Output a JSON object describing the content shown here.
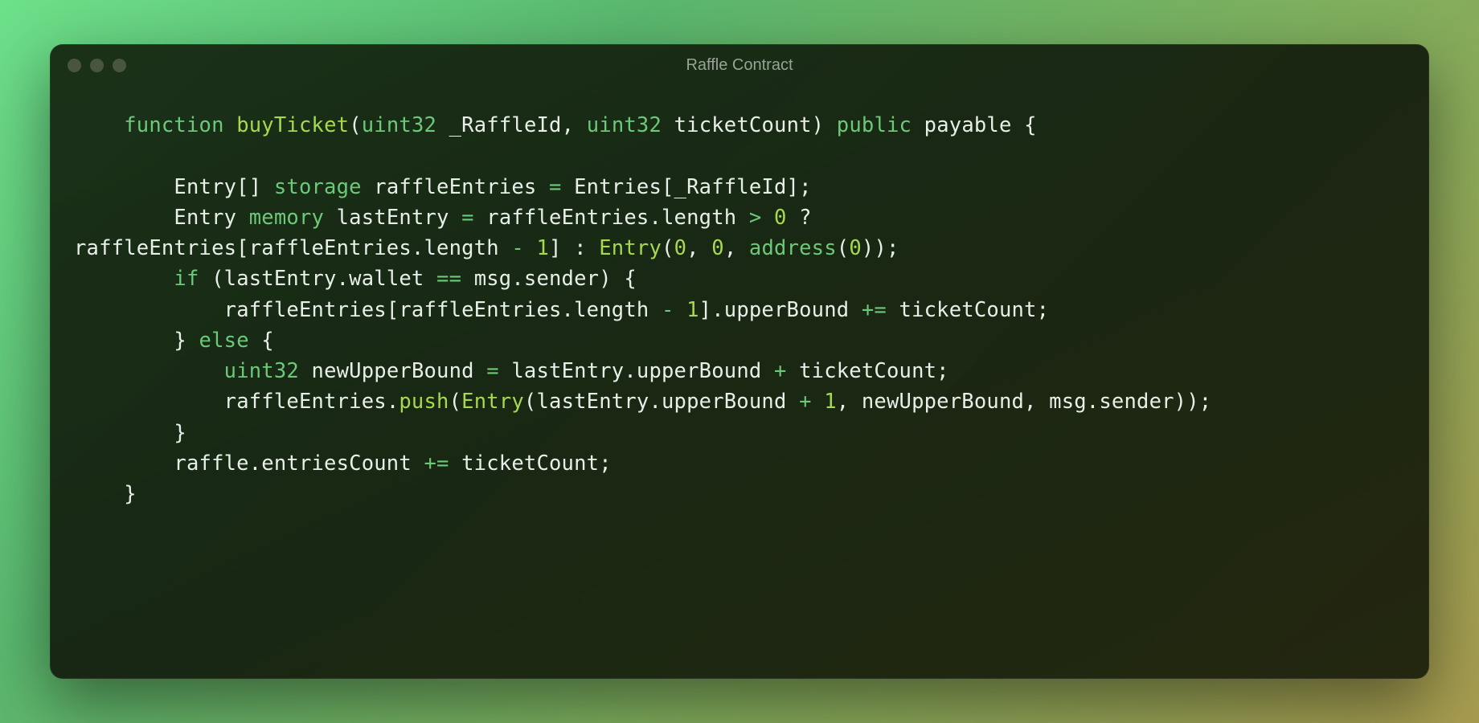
{
  "window": {
    "title": "Raffle Contract"
  },
  "colors": {
    "keyword": "#6cc979",
    "function": "#a7d94f",
    "number": "#a7d94f",
    "text": "#e8eee8",
    "titlebar_text": "#97a396",
    "dot": "#4a5540"
  },
  "code": {
    "lines": [
      {
        "indent": 1,
        "tokens": [
          {
            "t": "function ",
            "c": "kw"
          },
          {
            "t": "buyTicket",
            "c": "fn"
          },
          {
            "t": "(",
            "c": "pu"
          },
          {
            "t": "uint32",
            "c": "ty"
          },
          {
            "t": " _RaffleId, ",
            "c": "pu"
          },
          {
            "t": "uint32",
            "c": "ty"
          },
          {
            "t": " ticketCount) ",
            "c": "pu"
          },
          {
            "t": "public",
            "c": "kw"
          },
          {
            "t": " payable {",
            "c": "pu"
          }
        ]
      },
      {
        "indent": 0,
        "tokens": [
          {
            "t": "",
            "c": "pu"
          }
        ]
      },
      {
        "indent": 2,
        "tokens": [
          {
            "t": "Entry[] ",
            "c": "pu"
          },
          {
            "t": "storage",
            "c": "st"
          },
          {
            "t": " raffleEntries ",
            "c": "pu"
          },
          {
            "t": "=",
            "c": "op"
          },
          {
            "t": " Entries[_RaffleId];",
            "c": "pu"
          }
        ]
      },
      {
        "indent": 2,
        "tokens": [
          {
            "t": "Entry ",
            "c": "pu"
          },
          {
            "t": "memory",
            "c": "st"
          },
          {
            "t": " lastEntry ",
            "c": "pu"
          },
          {
            "t": "=",
            "c": "op"
          },
          {
            "t": " raffleEntries.length ",
            "c": "pu"
          },
          {
            "t": ">",
            "c": "op"
          },
          {
            "t": " ",
            "c": "pu"
          },
          {
            "t": "0",
            "c": "nm"
          },
          {
            "t": " ?",
            "c": "pu"
          }
        ]
      },
      {
        "indent": 0,
        "tokens": [
          {
            "t": "raffleEntries[raffleEntries.length ",
            "c": "pu"
          },
          {
            "t": "-",
            "c": "op"
          },
          {
            "t": " ",
            "c": "pu"
          },
          {
            "t": "1",
            "c": "nm"
          },
          {
            "t": "] : ",
            "c": "pu"
          },
          {
            "t": "Entry",
            "c": "cl"
          },
          {
            "t": "(",
            "c": "pu"
          },
          {
            "t": "0",
            "c": "nm"
          },
          {
            "t": ", ",
            "c": "pu"
          },
          {
            "t": "0",
            "c": "nm"
          },
          {
            "t": ", ",
            "c": "pu"
          },
          {
            "t": "address",
            "c": "ty"
          },
          {
            "t": "(",
            "c": "pu"
          },
          {
            "t": "0",
            "c": "nm"
          },
          {
            "t": "));",
            "c": "pu"
          }
        ]
      },
      {
        "indent": 2,
        "tokens": [
          {
            "t": "if",
            "c": "kw"
          },
          {
            "t": " (lastEntry.wallet ",
            "c": "pu"
          },
          {
            "t": "==",
            "c": "op"
          },
          {
            "t": " msg.sender) {",
            "c": "pu"
          }
        ]
      },
      {
        "indent": 3,
        "tokens": [
          {
            "t": "raffleEntries[raffleEntries.length ",
            "c": "pu"
          },
          {
            "t": "-",
            "c": "op"
          },
          {
            "t": " ",
            "c": "pu"
          },
          {
            "t": "1",
            "c": "nm"
          },
          {
            "t": "].upperBound ",
            "c": "pu"
          },
          {
            "t": "+=",
            "c": "op"
          },
          {
            "t": " ticketCount;",
            "c": "pu"
          }
        ]
      },
      {
        "indent": 2,
        "tokens": [
          {
            "t": "} ",
            "c": "pu"
          },
          {
            "t": "else",
            "c": "kw"
          },
          {
            "t": " {",
            "c": "pu"
          }
        ]
      },
      {
        "indent": 3,
        "tokens": [
          {
            "t": "uint32",
            "c": "ty"
          },
          {
            "t": " newUpperBound ",
            "c": "pu"
          },
          {
            "t": "=",
            "c": "op"
          },
          {
            "t": " lastEntry.upperBound ",
            "c": "pu"
          },
          {
            "t": "+",
            "c": "op"
          },
          {
            "t": " ticketCount;",
            "c": "pu"
          }
        ]
      },
      {
        "indent": 3,
        "tokens": [
          {
            "t": "raffleEntries.",
            "c": "pu"
          },
          {
            "t": "push",
            "c": "me"
          },
          {
            "t": "(",
            "c": "pu"
          },
          {
            "t": "Entry",
            "c": "cl"
          },
          {
            "t": "(lastEntry.upperBound ",
            "c": "pu"
          },
          {
            "t": "+",
            "c": "op"
          },
          {
            "t": " ",
            "c": "pu"
          },
          {
            "t": "1",
            "c": "nm"
          },
          {
            "t": ", newUpperBound, msg.sender));",
            "c": "pu"
          }
        ]
      },
      {
        "indent": 2,
        "tokens": [
          {
            "t": "}",
            "c": "pu"
          }
        ]
      },
      {
        "indent": 2,
        "tokens": [
          {
            "t": "raffle.entriesCount ",
            "c": "pu"
          },
          {
            "t": "+=",
            "c": "op"
          },
          {
            "t": " ticketCount;",
            "c": "pu"
          }
        ]
      },
      {
        "indent": 1,
        "tokens": [
          {
            "t": "}",
            "c": "pu"
          }
        ]
      }
    ],
    "indent_unit": "    "
  }
}
